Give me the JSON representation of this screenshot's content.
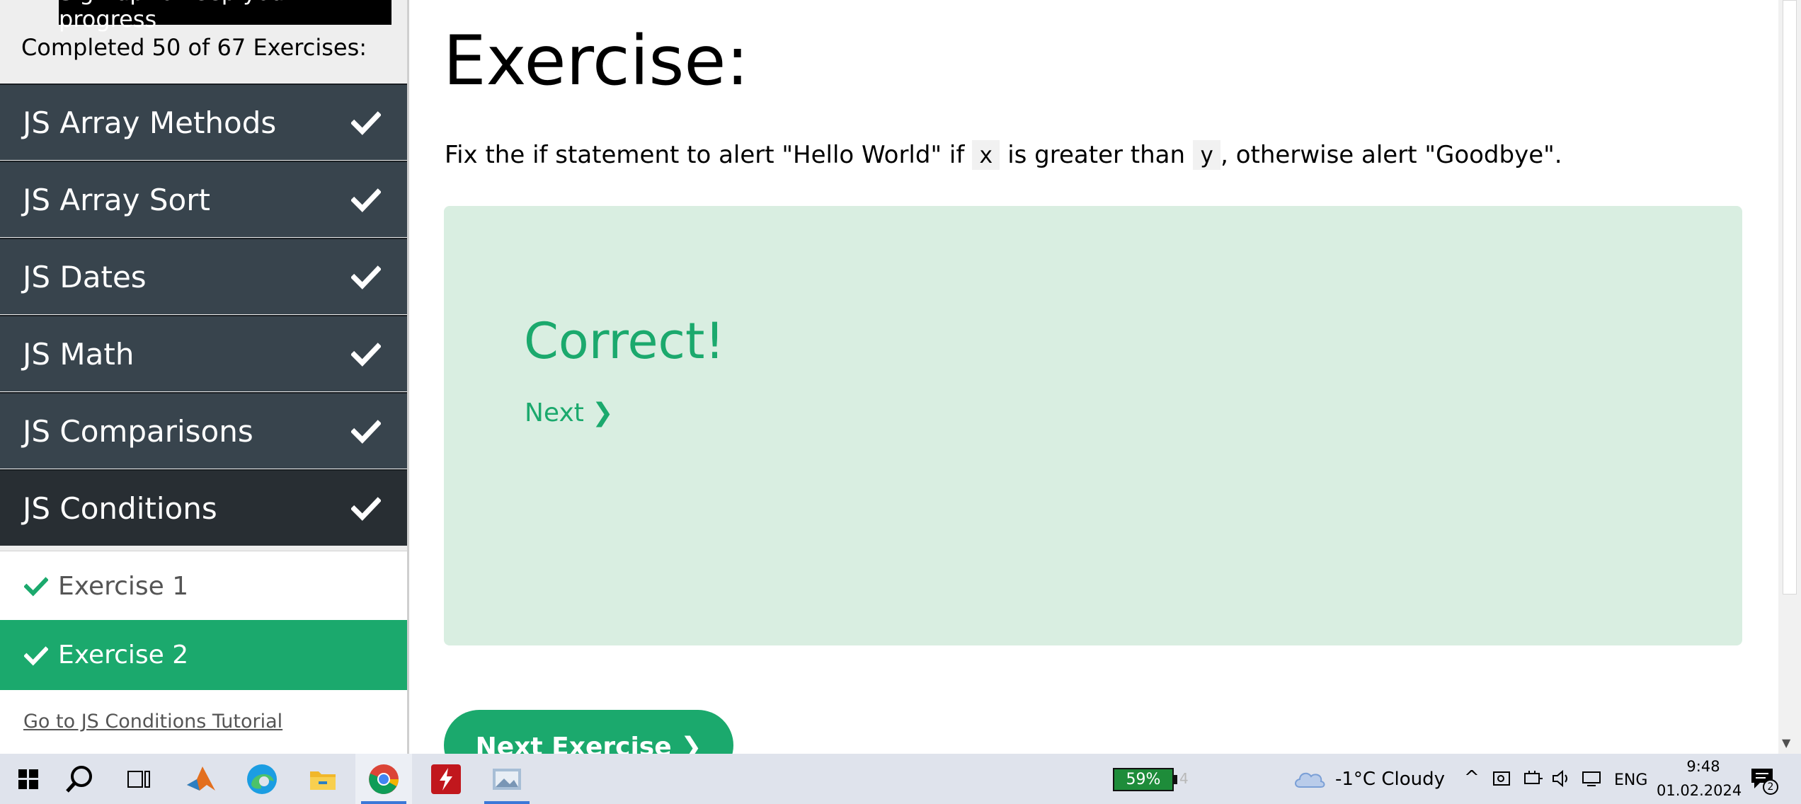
{
  "sidebar": {
    "signup_label": "Sign up to keep your progress",
    "progress_text": "Completed 50 of 67 Exercises:",
    "topics": [
      {
        "label": "JS Array Methods",
        "done": true
      },
      {
        "label": "JS Array Sort",
        "done": true
      },
      {
        "label": "JS Dates",
        "done": true
      },
      {
        "label": "JS Math",
        "done": true
      },
      {
        "label": "JS Comparisons",
        "done": true
      },
      {
        "label": "JS Conditions",
        "done": true,
        "active": true
      }
    ],
    "exercises": [
      {
        "label": "Exercise 1",
        "done": true
      },
      {
        "label": "Exercise 2",
        "done": true,
        "selected": true
      }
    ],
    "tutorial_link": "Go to JS Conditions Tutorial"
  },
  "main": {
    "heading": "Exercise:",
    "instruction": {
      "part1": "Fix the if statement to alert \"Hello World\" if ",
      "code_x": "x",
      "part2": " is greater than ",
      "code_y": "y",
      "part3": ", otherwise alert \"Goodbye\"."
    },
    "result": {
      "title": "Correct!",
      "next_label": "Next ❯"
    },
    "next_exercise_label": "Next Exercise ❯"
  },
  "taskbar": {
    "apps": [
      "start-icon",
      "search-icon",
      "task-view-icon",
      "matlab-icon",
      "edge-icon",
      "file-explorer-icon",
      "chrome-icon",
      "pdf-reader-icon",
      "image-viewer-icon"
    ],
    "battery_percent": "59%",
    "battery_level": 0.59,
    "battery_extra": "4",
    "weather": "-1°C  Cloudy",
    "language": "ENG",
    "time": "9:48",
    "date": "01.02.2024",
    "notifications": "2"
  },
  "colors": {
    "accent": "#1ba96d",
    "sidebar_dark": "#38444d",
    "result_bg": "#d9eee1"
  }
}
